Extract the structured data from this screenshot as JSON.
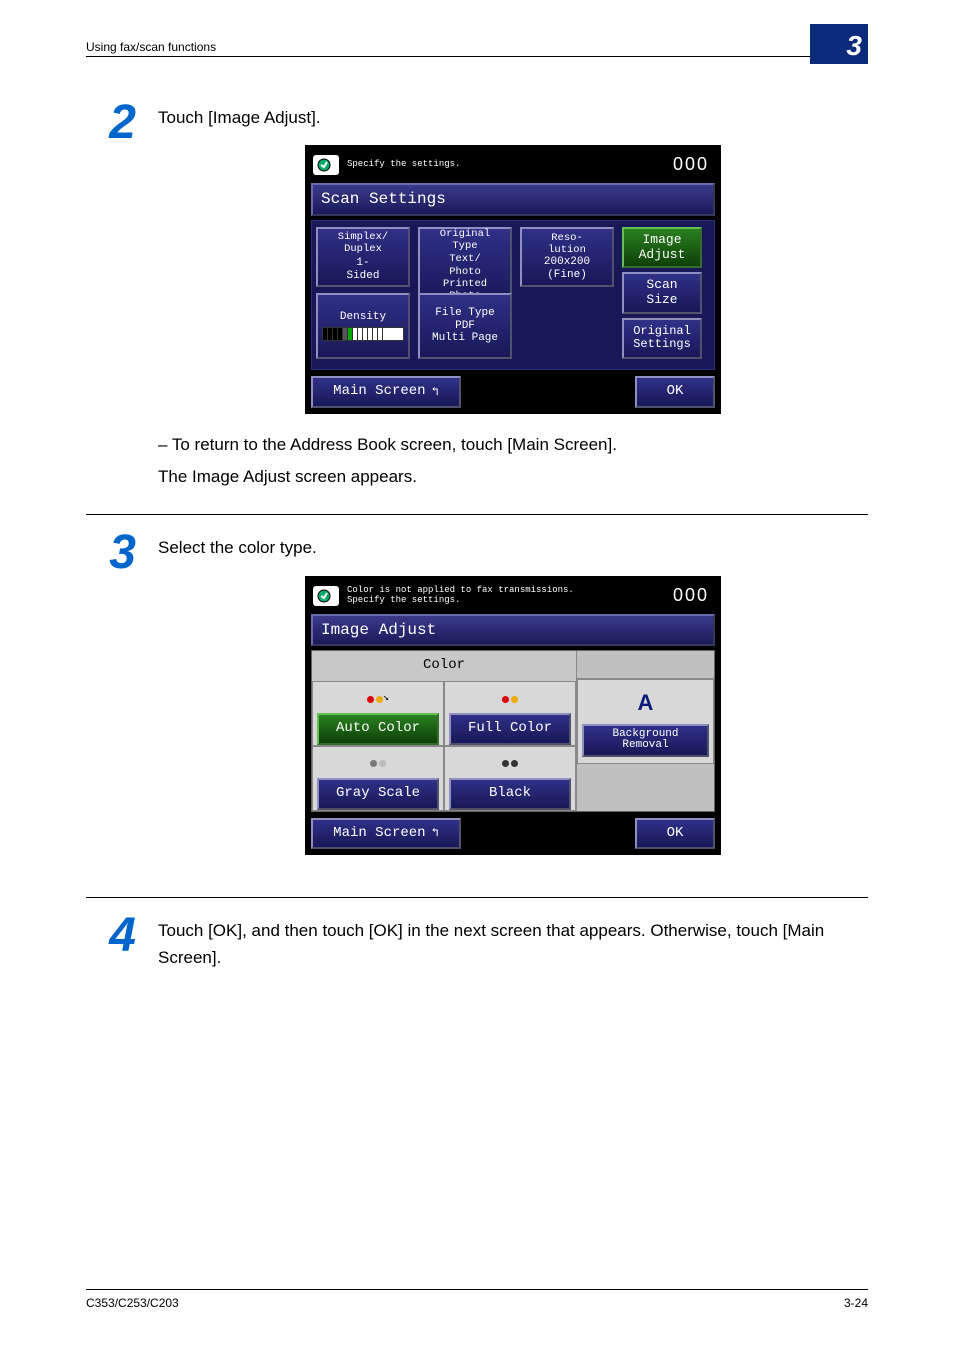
{
  "header": {
    "running": "Using fax/scan functions",
    "chapter": "3"
  },
  "steps": {
    "s2": {
      "num": "2",
      "text": "Touch [Image Adjust].",
      "note1": "–  To return to the Address Book screen, touch [Main Screen].",
      "note2": "The Image Adjust screen appears."
    },
    "s3": {
      "num": "3",
      "text": "Select the color type."
    },
    "s4": {
      "num": "4",
      "text": "Touch [OK], and then touch [OK] in the next screen that appears. Otherwise, touch [Main Screen]."
    }
  },
  "screen1": {
    "msg": "Specify the settings.",
    "count": "000",
    "title": "Scan Settings",
    "simplex": {
      "label": "Simplex/\nDuplex",
      "value": "1-\nSided"
    },
    "original": {
      "label": "Original\nType",
      "value1": "Text/\nPhoto",
      "value2": "Printed\nPhoto"
    },
    "reso": {
      "label": "Reso-\nlution",
      "value1": "200x200",
      "value2": "(Fine)"
    },
    "density": {
      "label": "Density"
    },
    "filetype": {
      "label": "File Type",
      "value1": "PDF",
      "value2": "Multi Page"
    },
    "side": {
      "imageAdjust": "Image\nAdjust",
      "scanSize": "Scan\nSize",
      "originalSettings": "Original\nSettings"
    },
    "mainScreen": "Main Screen",
    "ok": "OK"
  },
  "screen2": {
    "msg1": "Color is not applied to fax transmissions.",
    "msg2": "Specify the settings.",
    "count": "000",
    "title": "Image Adjust",
    "colorHeader": "Color",
    "autoColor": "Auto Color",
    "fullColor": "Full Color",
    "grayScale": "Gray Scale",
    "black": "Black",
    "bgRemoval": "Background\nRemoval",
    "mainScreen": "Main Screen",
    "ok": "OK"
  },
  "footer": {
    "model": "C353/C253/C203",
    "page": "3-24"
  }
}
